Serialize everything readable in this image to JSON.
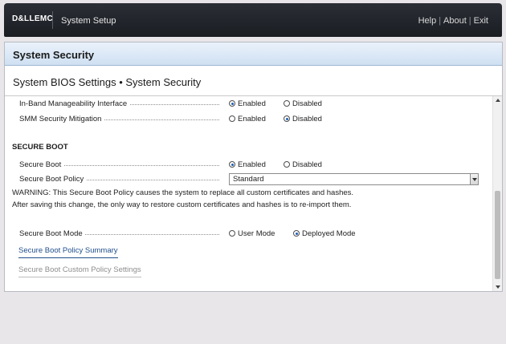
{
  "header": {
    "logo": "D&LLEMC",
    "title": "System Setup",
    "links": [
      "Help",
      "About",
      "Exit"
    ]
  },
  "panel": {
    "title": "System Security",
    "heading": "System BIOS Settings • System Security"
  },
  "settings": {
    "inband": {
      "label": "In-Band Manageability Interface",
      "options": [
        "Enabled",
        "Disabled"
      ],
      "selected": "Enabled"
    },
    "smm": {
      "label": "SMM Security Mitigation",
      "options": [
        "Enabled",
        "Disabled"
      ],
      "selected": "Disabled"
    }
  },
  "secure_boot_section": {
    "title": "SECURE BOOT",
    "secure_boot": {
      "label": "Secure Boot",
      "options": [
        "Enabled",
        "Disabled"
      ],
      "selected": "Enabled"
    },
    "policy": {
      "label": "Secure Boot Policy",
      "value": "Standard"
    },
    "warning": "WARNING: This Secure Boot Policy causes the system to replace all custom certificates and hashes. After saving this change, the only way to restore custom certificates and hashes is to re-import them.",
    "mode": {
      "label": "Secure Boot Mode",
      "options": [
        "User Mode",
        "Deployed Mode"
      ],
      "selected": "Deployed Mode"
    },
    "links": {
      "summary": "Secure Boot Policy Summary",
      "custom": "Secure Boot Custom Policy Settings"
    }
  },
  "colors": {
    "accent": "#1f5fb5",
    "header_bg": "#1f2228",
    "panel_head": "#d9e7f5"
  }
}
